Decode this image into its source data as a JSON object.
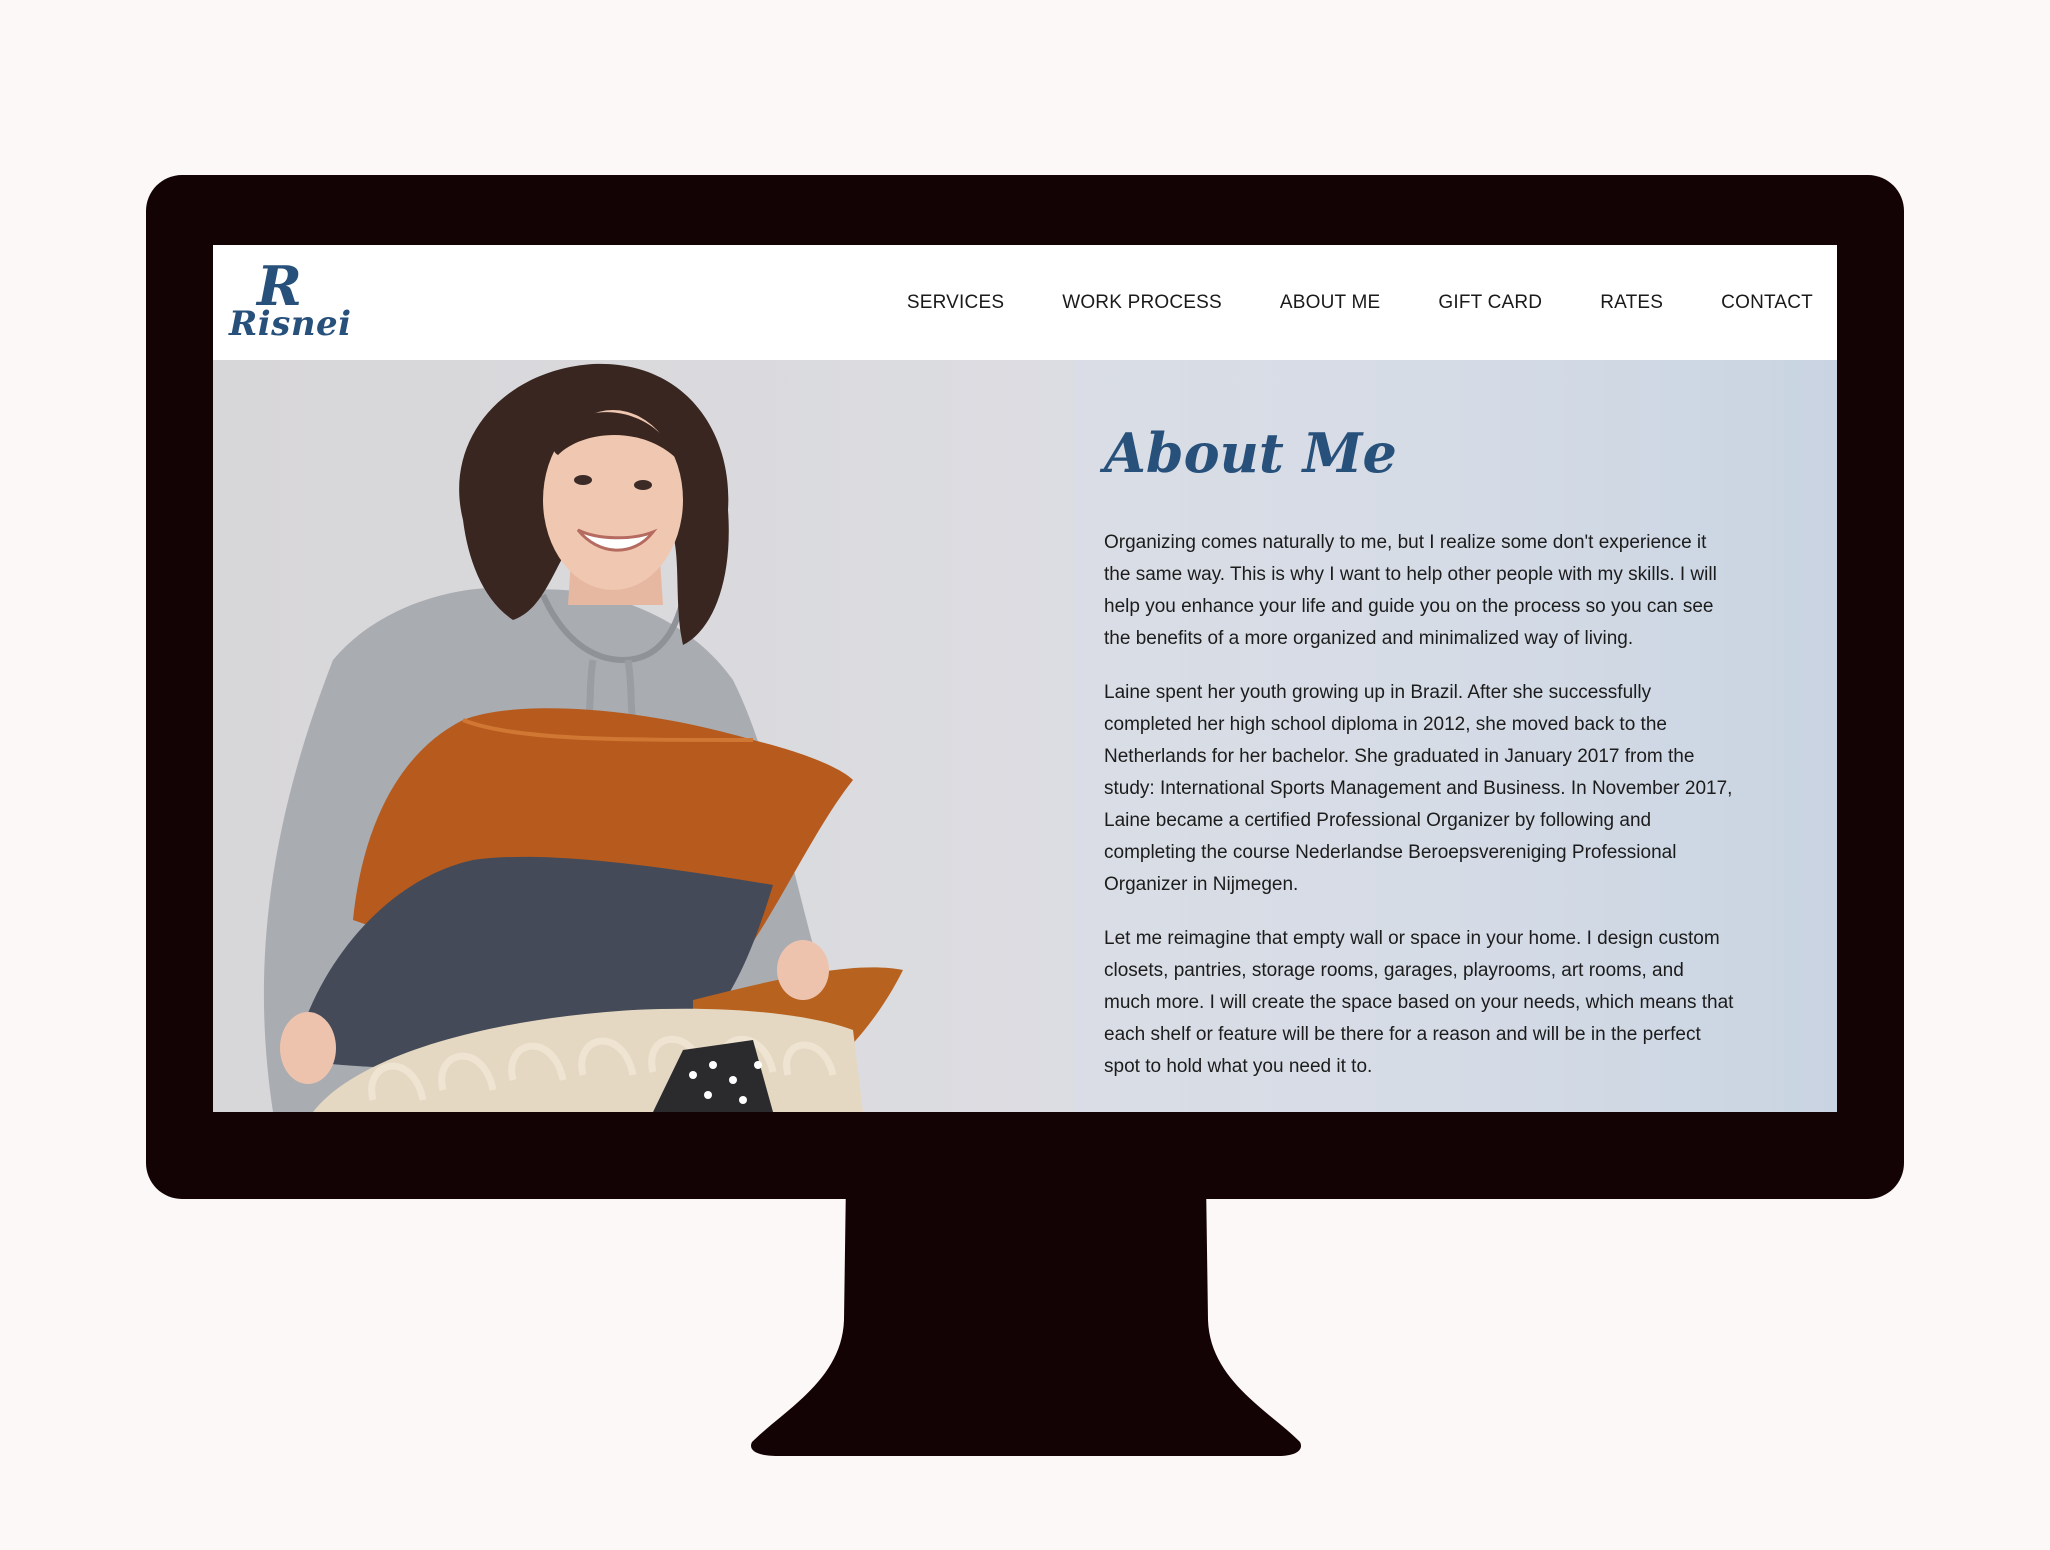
{
  "brand": {
    "logo_mark": "R",
    "logo_word": "Risnei",
    "accent_color": "#27507b"
  },
  "nav": {
    "items": [
      {
        "label": "SERVICES"
      },
      {
        "label": "WORK PROCESS"
      },
      {
        "label": "ABOUT ME"
      },
      {
        "label": "GIFT CARD"
      },
      {
        "label": "RATES"
      },
      {
        "label": "CONTACT"
      }
    ]
  },
  "about": {
    "title": "About Me",
    "paragraphs": [
      "Organizing comes naturally to me, but I realize some don't experience it the same way. This is why I want to help other people with my skills. I will help you enhance your life and guide you on the process so you can see the benefits of a more organized and minimalized way of living.",
      "Laine spent her youth growing up in Brazil. After she successfully completed her high school diploma in 2012, she moved back to the Netherlands for her bachelor. She graduated in January 2017 from the study: International Sports Management and Business. In November 2017, Laine became a certified Professional Organizer by following and completing the course Nederlandse Beroepsvereniging Professional Organizer in Nijmegen.",
      "Let me reimagine that empty wall or space in your home. I design custom closets, pantries, storage rooms, garages, playrooms, art rooms, and much more. I will create the space based on your needs, which means that each shelf or feature will be there for a reason and will be in the perfect spot to hold what you need it to."
    ]
  }
}
